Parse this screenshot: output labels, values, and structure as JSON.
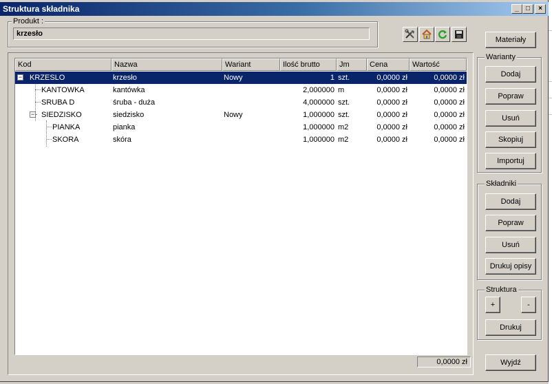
{
  "window": {
    "title": "Struktura składnika"
  },
  "titlebar_buttons": {
    "minimize": "_",
    "maximize": "□",
    "close": "×"
  },
  "produkt": {
    "label": "Produkt :",
    "value": "krzesło"
  },
  "toolbar_icons": [
    "tools-icon",
    "home-icon",
    "refresh-icon",
    "save-icon"
  ],
  "grid": {
    "columns": [
      "Kod",
      "Nazwa",
      "Wariant",
      "Ilość brutto",
      "Jm",
      "Cena",
      "Wartość"
    ],
    "rows": [
      {
        "kod": "KRZESLO",
        "nazwa": "krzesło",
        "wariant": "Nowy",
        "ilosc": "1",
        "jm": "szt.",
        "cena": "0,0000 zł",
        "wartosc": "0,0000 zł",
        "level": 0,
        "expander": "−"
      },
      {
        "kod": "KANTOWKA",
        "nazwa": "kantówka",
        "wariant": "",
        "ilosc": "2,000000",
        "jm": "m",
        "cena": "0,0000 zł",
        "wartosc": "0,0000 zł",
        "level": 1,
        "expander": ""
      },
      {
        "kod": "SRUBA D",
        "nazwa": "śruba - duża",
        "wariant": "",
        "ilosc": "4,000000",
        "jm": "szt.",
        "cena": "0,0000 zł",
        "wartosc": "0,0000 zł",
        "level": 1,
        "expander": ""
      },
      {
        "kod": "SIEDZISKO",
        "nazwa": "siedzisko",
        "wariant": "Nowy",
        "ilosc": "1,000000",
        "jm": "szt.",
        "cena": "0,0000 zł",
        "wartosc": "0,0000 zł",
        "level": 1,
        "expander": "−"
      },
      {
        "kod": "PIANKA",
        "nazwa": "pianka",
        "wariant": "",
        "ilosc": "1,000000",
        "jm": "m2",
        "cena": "0,0000 zł",
        "wartosc": "0,0000 zł",
        "level": 2,
        "expander": ""
      },
      {
        "kod": "SKORA",
        "nazwa": "skóra",
        "wariant": "",
        "ilosc": "1,000000",
        "jm": "m2",
        "cena": "0,0000 zł",
        "wartosc": "0,0000 zł",
        "level": 2,
        "expander": ""
      }
    ],
    "selected_row": 0,
    "total": "0,0000 zł"
  },
  "buttons": {
    "materialy": "Materiały",
    "warianty": {
      "legend": "Warianty",
      "dodaj": "Dodaj",
      "popraw": "Popraw",
      "usun": "Usuń",
      "skopiuj": "Skopiuj",
      "importuj": "Importuj"
    },
    "skladniki": {
      "legend": "Składniki",
      "dodaj": "Dodaj",
      "popraw": "Popraw",
      "usun": "Usuń",
      "drukuj_opisy": "Drukuj opisy"
    },
    "struktura": {
      "legend": "Struktura",
      "plus": "+",
      "minus": "-",
      "drukuj": "Drukuj"
    },
    "wyjdz": "Wyjdź"
  },
  "colors": {
    "selection": "#0a246a",
    "titlebar": "#0a246a",
    "face": "#d4d0c8"
  }
}
